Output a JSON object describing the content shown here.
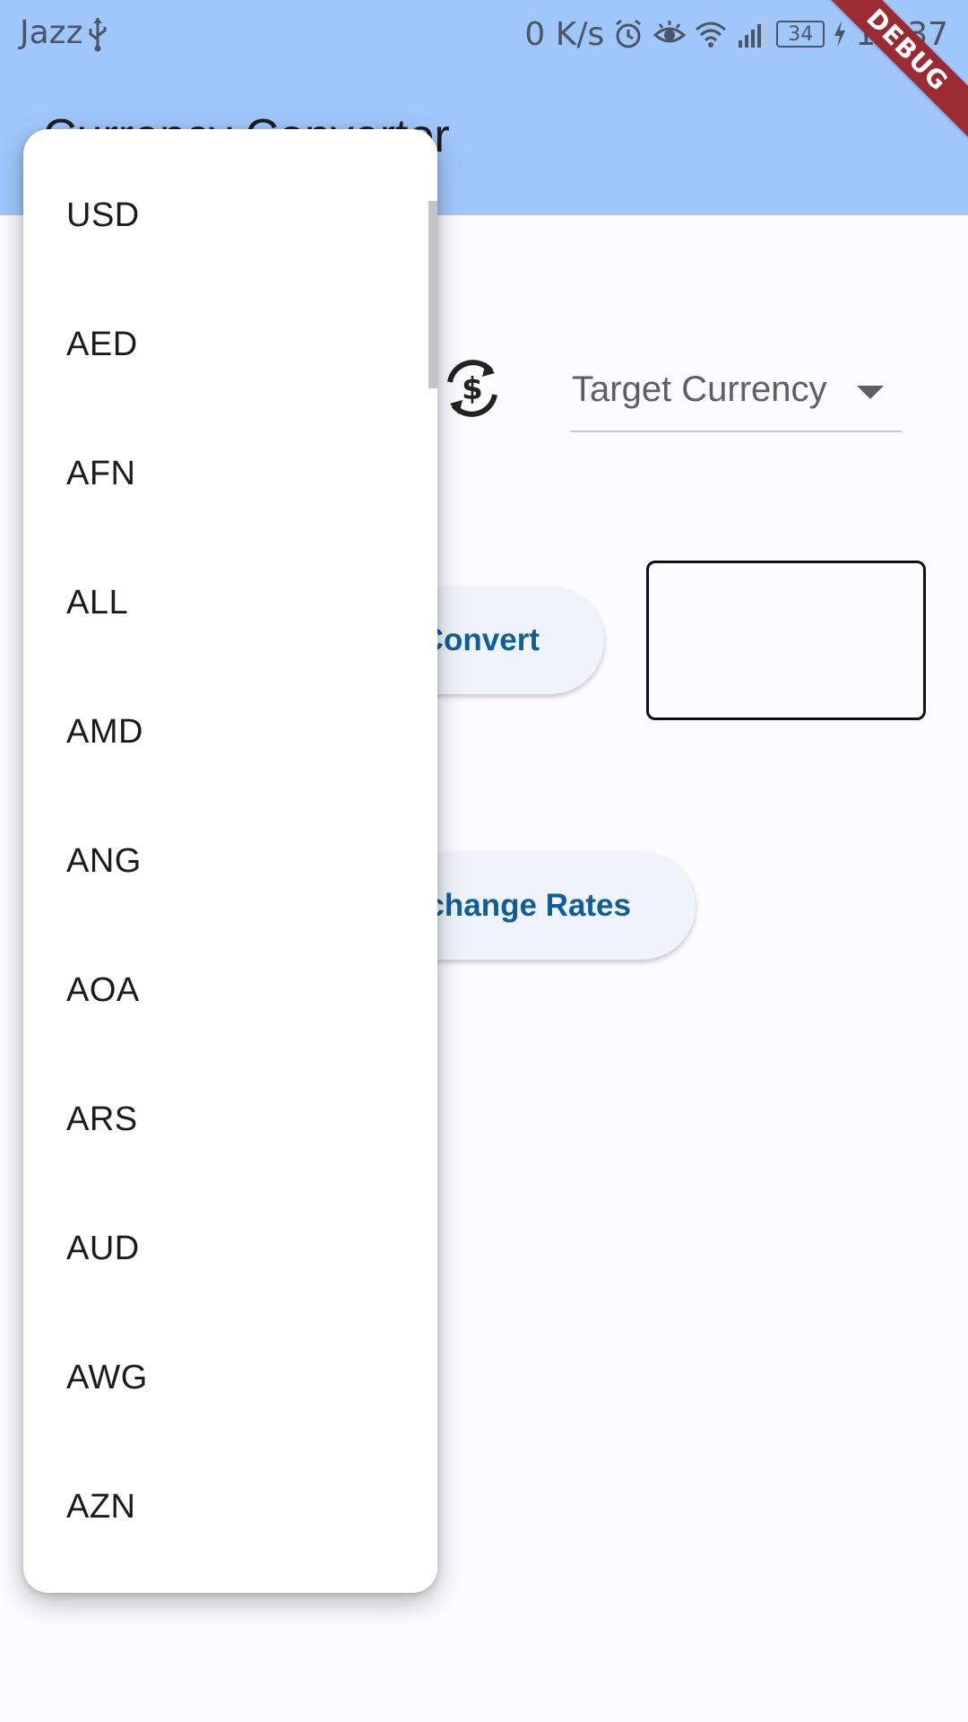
{
  "status_bar": {
    "carrier": "Jazz",
    "speed": "0 K/s",
    "battery": "34",
    "time": "11:37"
  },
  "app_bar": {
    "title": "Currency Converter"
  },
  "debug_banner": "DEBUG",
  "controls": {
    "target_currency_hint": "Target Currency",
    "convert_label": "Convert",
    "exchange_rates_label": "Exchange Rates"
  },
  "currency_menu": {
    "items": [
      "USD",
      "AED",
      "AFN",
      "ALL",
      "AMD",
      "ANG",
      "AOA",
      "ARS",
      "AUD",
      "AWG",
      "AZN"
    ]
  },
  "colors": {
    "app_bar": "#a0c7fc",
    "button_text": "#0f5e99",
    "debug_ribbon": "#9c2a33"
  }
}
